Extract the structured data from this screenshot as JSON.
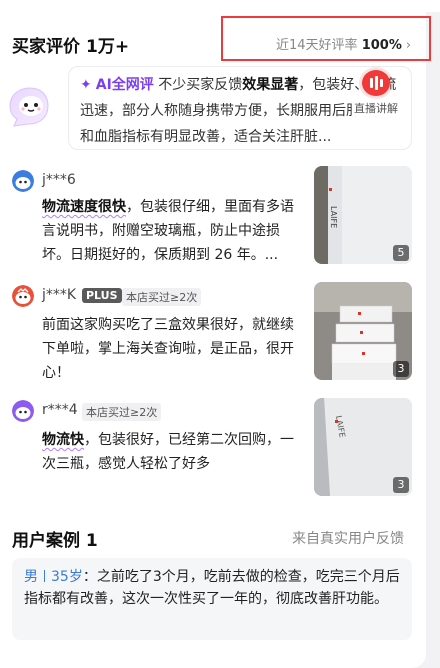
{
  "header": {
    "title": "买家评价",
    "count": "1万+",
    "rate_text": "近14天好评率",
    "rate_value": "100%",
    "chevron": "›"
  },
  "ai_summary": {
    "label": "AI全网评",
    "segments": [
      {
        "text": "不少买家反馈",
        "bold": false
      },
      {
        "text": "效果显著",
        "bold": true
      },
      {
        "text": "，包装好、物流迅速，部分人称随身携带方便，长期服用后肝功能和血脂指标有明显改善，适合关注肝脏...",
        "bold": false
      }
    ],
    "live_label": "直播讲解"
  },
  "reviews": [
    {
      "user": "j***6",
      "badges": [],
      "highlight": "物流速度很快",
      "text": "，包装很仔细，里面有多语言说明书，附赠空玻璃瓶，防止中途损坏。日期挺好的，保质期到 26 年。...",
      "image_count": "5",
      "avatar_color": "#3b7de0"
    },
    {
      "user": "j***K",
      "badges": [
        "PLUS",
        "本店买过≥2次"
      ],
      "highlight": "",
      "text": "前面这家购买吃了三盒效果很好，就继续下单啦，掌上海关查询啦，是正品，很开心！",
      "image_count": "3",
      "avatar_color": "#e8523a"
    },
    {
      "user": "r***4",
      "badges": [
        "本店买过≥2次"
      ],
      "highlight": "物流快",
      "text": "，包装很好，已经第二次回购，一次三瓶，感觉人轻松了好多",
      "image_count": "3",
      "avatar_color": "#8c5cf0"
    }
  ],
  "cases": {
    "title": "用户案例",
    "count": "1",
    "source": "来自真实用户反馈",
    "gender": "男",
    "age": "35岁",
    "text": "：之前吃了3个月，吃前去做的检查，吃完三个月后指标都有改善，这次一次性买了一年的，彻底改善肝功能。"
  },
  "colors": {
    "accent_red": "#ee3a3a",
    "ai_purple": "#7b3ff2",
    "case_blue": "#3a7bd5"
  }
}
